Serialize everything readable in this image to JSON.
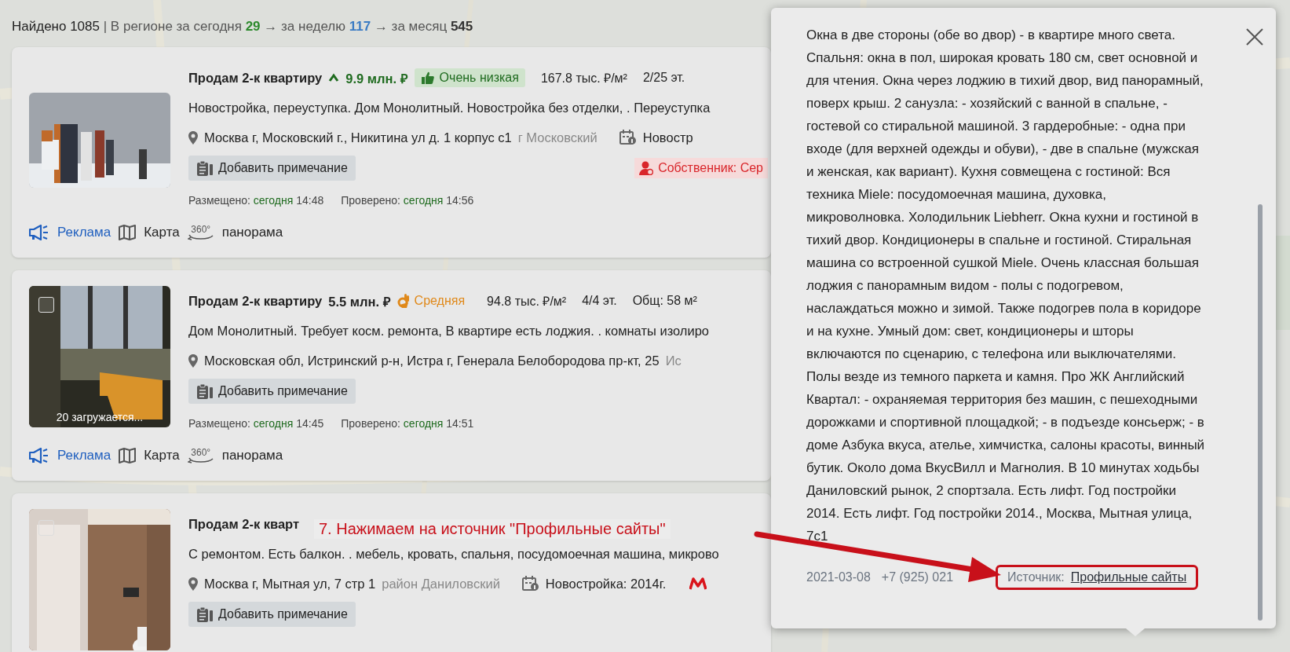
{
  "summary": {
    "found": "Найдено 1085",
    "parts": [
      {
        "text": "| В регионе за сегодня",
        "count": "29",
        "color": "#2d8a2d"
      },
      {
        "text": "→ за неделю",
        "count": "117",
        "color": "#3b7cc4"
      },
      {
        "text": "→ за месяц",
        "count": "545",
        "color": "#333333"
      }
    ]
  },
  "listings": [
    {
      "photo": {
        "kind": "building"
      },
      "title": "Продам 2-к квартиру",
      "price": "9.9 млн. ₽",
      "price_rising": true,
      "rating": {
        "kind": "low",
        "label": "Очень низкая"
      },
      "facts": [
        "167.8 тыс. ₽/м²",
        "2/25 эт."
      ],
      "description": "Новостройка, переуступка. Дом Монолитный. Новостройка без отделки, . Переуступка",
      "address": "Москва г, Московский г., Никитина ул д. 1 корпус с1",
      "district": "г Московский",
      "building": "Новостр",
      "note_button": "Добавить примечание",
      "owner": "Собственник: Сер",
      "placed_label": "Размещено:",
      "placed_day": "сегодня",
      "placed_time": "14:48",
      "checked_label": "Проверено:",
      "checked_day": "сегодня",
      "checked_time": "14:56",
      "links": [
        {
          "kind": "ad",
          "label": "Реклама"
        },
        {
          "kind": "map",
          "label": "Карта"
        },
        {
          "kind": "panorama",
          "label": "панорама",
          "icon_text": "360°"
        }
      ]
    },
    {
      "photo": {
        "kind": "balcony",
        "caption": "20 загружается..."
      },
      "checkbox": {
        "checked": false
      },
      "title": "Продам 2-к квартиру",
      "price": "5.5 млн. ₽",
      "rating": {
        "kind": "medium",
        "label": "Средняя"
      },
      "facts": [
        "94.8 тыс. ₽/м²",
        "4/4 эт.",
        "Общ: 58 м²"
      ],
      "description": "Дом Монолитный. Требует косм. ремонта, В квартире есть лоджия. . комнаты изолиро",
      "address": "Московская обл, Истринский р-н, Истра г, Генерала Белобородова пр-кт, 25",
      "district": "Ис",
      "note_button": "Добавить примечание",
      "placed_label": "Размещено:",
      "placed_day": "сегодня",
      "placed_time": "14:45",
      "checked_label": "Проверено:",
      "checked_day": "сегодня",
      "checked_time": "14:51",
      "links": [
        {
          "kind": "ad",
          "label": "Реклама"
        },
        {
          "kind": "map",
          "label": "Карта"
        },
        {
          "kind": "panorama",
          "label": "панорама",
          "icon_text": "360°"
        }
      ]
    },
    {
      "photo": {
        "kind": "bathroom"
      },
      "checkbox": {
        "checked": false
      },
      "title": "Продам 2-к кварт",
      "description": "С ремонтом. Есть балкон. . мебель, кровать, спальня, посудомоечная машина, микрово",
      "address": "Москва г, Мытная ул, 7 стр 1",
      "district": "район Даниловский",
      "building": "Новостройка: 2014г.",
      "metro": true,
      "note_button": "Добавить примечание"
    }
  ],
  "popup": {
    "text": "Окна в две стороны (обе во двор) - в квартире много света. Спальня: окна в пол, широкая кровать 180 см, свет основной и для чтения. Окна через лоджию в тихий двор, вид панорамный, поверх крыш. 2 санузла: - хозяйский с ванной в спальне, - гостевой со стиральной машиной. 3 гардеробные: - одна при входе (для верхней одежды и обуви), - две в спальне (мужская и женская, как вариант). Кухня совмещена с гостиной: Вся техника Miele: посудомоечная машина, духовка, микроволновка. Холодильник Liebherr. Окна кухни и гостиной в тихий двор. Кондиционеры в спальне и гостиной. Стиральная машина со встроенной сушкой Miele. Очень классная большая лоджия с панорамным видом - полы с подогревом, наслаждаться можно и зимой. Также подогрев пола в коридоре и на кухне. Умный дом: свет, кондиционеры и шторы включаются по сценарию, с телефона или выключателями. Полы везде из темного паркета и камня. Про ЖК Английский Квартал: - охраняемая территория без машин, с пешеходными дорожками и спортивной площадкой; - в подъезде консьерж; - в доме Азбука вкуса, ателье, химчистка, салоны красоты, винный бутик. Около дома ВкусВилл и Магнолия. В 10 минутах ходьбы Даниловский рынок, 2 спортзала. Есть лифт. Год постройки 2014. Есть лифт. Год постройки 2014., Москва, Мытная улица, 7с1",
    "date": "2021-03-08",
    "phone": "+7 (925) 021",
    "source_label": "Источник:",
    "source_link": "Профильные сайты"
  },
  "annotation": {
    "text": "7. Нажимаем на источник \"Профильные сайты\""
  }
}
